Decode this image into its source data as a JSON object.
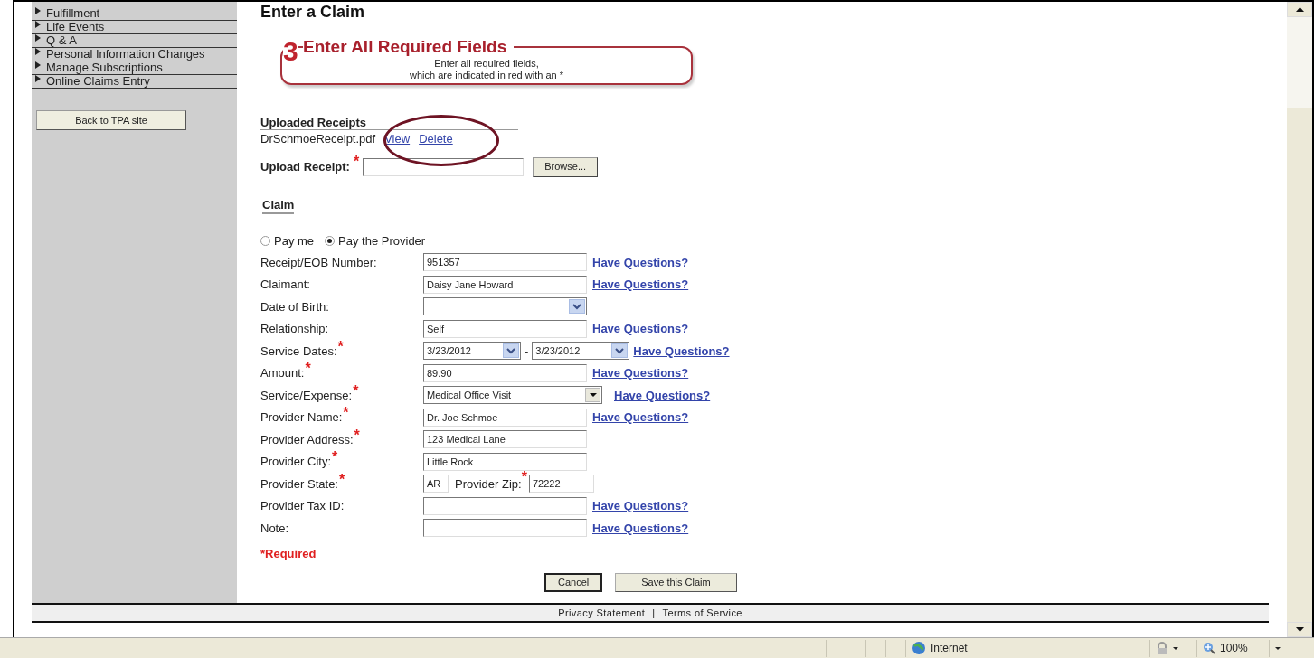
{
  "sidebar": {
    "items": [
      {
        "label": "Fulfillment"
      },
      {
        "label": "Life Events"
      },
      {
        "label": "Q & A"
      },
      {
        "label": "Personal Information Changes"
      },
      {
        "label": "Manage Subscriptions"
      },
      {
        "label": "Online Claims Entry"
      }
    ],
    "back_button": "Back to TPA site"
  },
  "page_title": "Enter a Claim",
  "step": {
    "number": "3",
    "title": "Enter All Required Fields",
    "lines": [
      "Enter all required fields,",
      "which are indicated in red with an *"
    ]
  },
  "uploaded": {
    "heading": "Uploaded Receipts",
    "file": "DrSchmoeReceipt.pdf",
    "links": [
      "View",
      "Delete"
    ]
  },
  "upload": {
    "label": "Upload Receipt:",
    "mark": "*",
    "button": "Browse..."
  },
  "section": "Claim",
  "payee": [
    {
      "label": "Pay me",
      "selected": false
    },
    {
      "label": "Pay the Provider",
      "selected": true
    }
  ],
  "fields": [
    {
      "kind": "text",
      "label": "Receipt/EOB Number:",
      "value": "951357",
      "help": "Have Questions?"
    },
    {
      "kind": "text",
      "label": "Claimant:",
      "value": "Daisy Jane Howard",
      "help": "Have Questions?"
    },
    {
      "kind": "combo",
      "label": "Date of Birth:"
    },
    {
      "kind": "text",
      "label": "Relationship:",
      "value": "Self",
      "help": "Have Questions?"
    },
    {
      "kind": "daterange",
      "label": "Service Dates:",
      "mark": "*",
      "from": "3/23/2012",
      "separator": "-",
      "to": "3/23/2012",
      "help": "Have Questions?"
    },
    {
      "kind": "text",
      "label": "Amount:",
      "mark": "*",
      "value": "89.90",
      "help": "Have Questions?"
    },
    {
      "kind": "dropdown",
      "label": "Service/Expense:",
      "mark": "*",
      "value": "Medical Office Visit",
      "help": "Have Questions?"
    },
    {
      "kind": "text",
      "label": "Provider Name:",
      "mark": "*",
      "value": "Dr. Joe Schmoe",
      "help": "Have Questions?"
    },
    {
      "kind": "text",
      "label": "Provider Address:",
      "mark": "*",
      "value": "123 Medical Lane"
    },
    {
      "kind": "text",
      "label": "Provider City:",
      "mark": "*",
      "value": "Little Rock"
    },
    {
      "kind": "statezip",
      "label": "Provider State:",
      "mark": "*",
      "value": "AR",
      "zip_label": "Provider Zip:",
      "zip_mark": "*",
      "zip_value": "72222"
    },
    {
      "kind": "text",
      "label": "Provider Tax ID:",
      "help": "Have Questions?"
    },
    {
      "kind": "text",
      "label": "Note:",
      "help": "Have Questions?"
    }
  ],
  "required_note": {
    "mark": "*",
    "text": "Required"
  },
  "buttons": [
    {
      "label": "Cancel",
      "default": true
    },
    {
      "label": "Save this Claim",
      "default": false
    }
  ],
  "footer": {
    "links": [
      "Privacy Statement",
      "Terms of Service"
    ],
    "separator": "|"
  },
  "status_bar": {
    "zone": "Internet",
    "zoom": "100%"
  }
}
